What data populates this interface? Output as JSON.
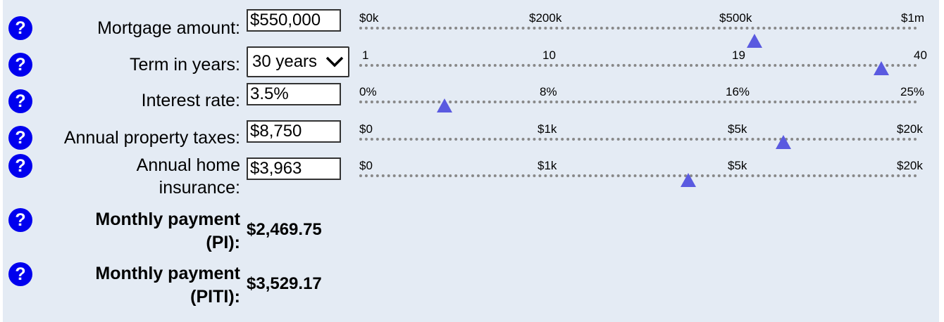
{
  "rows": [
    {
      "label": "Mortgage amount:",
      "value": "$550,000",
      "ticks": [
        "$0k",
        "$200k",
        "$500k",
        "$1m"
      ]
    },
    {
      "label": "Term in years:",
      "value": "30 years",
      "ticks": [
        "1",
        "10",
        "19",
        "40"
      ]
    },
    {
      "label": "Interest rate:",
      "value": "3.5%",
      "ticks": [
        "0%",
        "8%",
        "16%",
        "25%"
      ]
    },
    {
      "label": "Annual property taxes:",
      "value": "$8,750",
      "ticks": [
        "$0",
        "$1k",
        "$5k",
        "$20k"
      ]
    },
    {
      "label_line1": "Annual home",
      "label_line2": "insurance:",
      "value": "$3,963",
      "ticks": [
        "$0",
        "$1k",
        "$5k",
        "$20k"
      ]
    }
  ],
  "results": [
    {
      "label_line1": "Monthly payment",
      "label_line2": "(PI):",
      "value": "$2,469.75"
    },
    {
      "label_line1": "Monthly payment",
      "label_line2": "(PITI):",
      "value": "$3,529.17"
    }
  ],
  "help_symbol": "?",
  "colors": {
    "help": "#0000ee",
    "thumb": "#5a5ae0",
    "panel": "#e4ebf4"
  }
}
